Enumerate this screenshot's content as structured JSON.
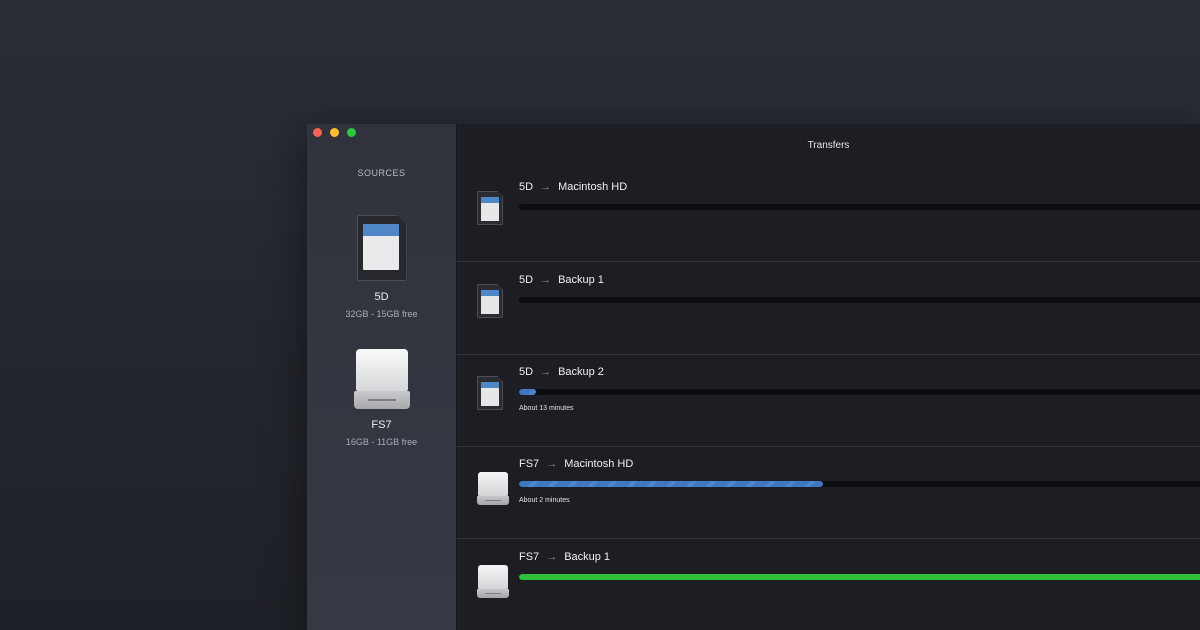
{
  "window": {
    "title": "Transfers",
    "traffic_lights": [
      "close",
      "minimize",
      "zoom"
    ]
  },
  "sidebar": {
    "title": "SOURCES",
    "sources": [
      {
        "name": "5D",
        "capacity": "32GB - 15GB free",
        "icon": "sd-card-icon"
      },
      {
        "name": "FS7",
        "capacity": "16GB - 11GB free",
        "icon": "external-drive-icon"
      }
    ]
  },
  "transfers": [
    {
      "source": "5D",
      "destination": "Macintosh HD",
      "icon": "sd-card-icon",
      "progress": 0.0,
      "eta": "",
      "status": "queued"
    },
    {
      "source": "5D",
      "destination": "Backup 1",
      "icon": "sd-card-icon",
      "progress": 0.0,
      "eta": "",
      "status": "queued"
    },
    {
      "source": "5D",
      "destination": "Backup 2",
      "icon": "sd-card-icon",
      "progress": 0.025,
      "eta": "About 13 minutes",
      "status": "in-progress"
    },
    {
      "source": "FS7",
      "destination": "Macintosh HD",
      "icon": "external-drive-icon",
      "progress": 0.44,
      "eta": "About 2 minutes",
      "status": "in-progress"
    },
    {
      "source": "FS7",
      "destination": "Backup 1",
      "icon": "external-drive-icon",
      "progress": 1.0,
      "eta": "",
      "status": "complete"
    }
  ],
  "colors": {
    "progress_active": "#3f78c0",
    "progress_complete": "#2fbf3a",
    "sd_label_band": "#4f86c6"
  }
}
